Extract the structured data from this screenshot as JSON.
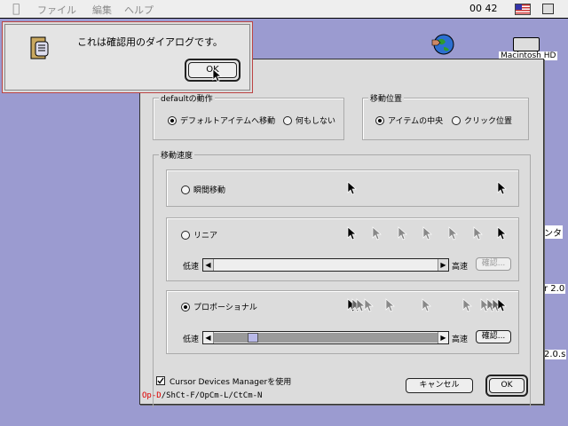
{
  "menubar": {
    "items": [
      "ファイル",
      "編集",
      "ヘルプ"
    ],
    "clock": "00 42"
  },
  "desktop": {
    "hd_label": "Macintosh HD",
    "edge_texts": [
      "ンタ",
      "r 2.0",
      "2.0.s"
    ]
  },
  "alert": {
    "message": "これは確認用のダイアログです。",
    "ok_label": "OK"
  },
  "panel": {
    "default_group": {
      "title": "defaultの動作",
      "options": [
        "デフォルトアイテムへ移動",
        "何もしない"
      ],
      "selected": 0
    },
    "position_group": {
      "title": "移動位置",
      "options": [
        "アイテムの中央",
        "クリック位置"
      ],
      "selected": 0
    },
    "speed_group": {
      "title": "移動速度",
      "modes": {
        "instant": "瞬間移動",
        "linear": "リニア",
        "proportional": "プロポーショナル"
      },
      "selected": "proportional",
      "slow_label": "低速",
      "fast_label": "高速",
      "confirm_label": "確認...",
      "linear_slider_value": 0,
      "proportional_slider_value": 0.15
    },
    "use_checkbox_label": "Cursor Devices Managerを使用",
    "use_checked": true,
    "shortcut_red": "Op-D",
    "shortcut_rest": "/ShCt-F/OpCm-L/CtCm-N",
    "cancel_label": "キャンセル",
    "ok_label": "OK"
  },
  "colors": {
    "desktop": "#9b9bd0",
    "panel": "#dcdcdc",
    "shortcut_highlight": "#dd0000"
  },
  "icons": [
    "apple-icon",
    "flag-icon",
    "app-menu-icon",
    "globe-icon",
    "hard-disk-icon",
    "alert-icon",
    "arrow-cursor-icon",
    "checkbox-check-icon"
  ]
}
